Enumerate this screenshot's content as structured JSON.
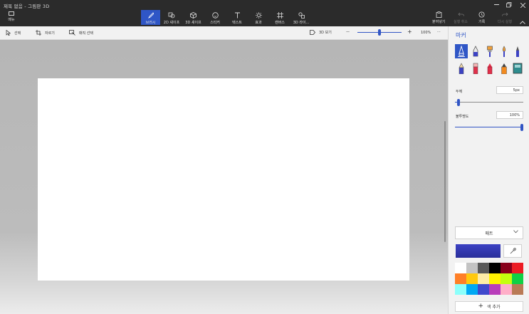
{
  "window": {
    "title": "제목 없음 - 그림판 3D"
  },
  "topbar": {
    "menu_label": "메뉴",
    "tools": [
      {
        "label": "브러시",
        "icon": "brush-icon"
      },
      {
        "label": "2D 셰이프",
        "icon": "2d-shapes-icon"
      },
      {
        "label": "3D 셰이프",
        "icon": "3d-shapes-icon"
      },
      {
        "label": "스티커",
        "icon": "sticker-icon"
      },
      {
        "label": "텍스트",
        "icon": "text-icon"
      },
      {
        "label": "효과",
        "icon": "effects-icon"
      },
      {
        "label": "캔버스",
        "icon": "canvas-icon"
      },
      {
        "label": "3D 라이...",
        "icon": "3d-library-icon"
      }
    ],
    "paste_label": "붙여넣기",
    "undo_label": "실행 취소",
    "history_label": "기록",
    "redo_label": "다시 실행"
  },
  "subbar": {
    "select_label": "선택",
    "crop_label": "자르기",
    "magic_select_label": "매직 선택",
    "view3d_label": "3D 보기",
    "zoom_minus": "—",
    "zoom_plus": "+",
    "zoom_percent": "100%",
    "more": "···",
    "zoom_fraction": 0.5
  },
  "panel": {
    "title": "마커",
    "thickness_label": "두께",
    "thickness_value": "5px",
    "thickness_fraction": 0.03,
    "opacity_label": "불투명도",
    "opacity_value": "100%",
    "opacity_fraction": 1.0,
    "finish_dropdown": "매트",
    "selected_color": "#3c42c3",
    "add_color_label": "색 추가",
    "brushes": [
      "marker-icon",
      "calligraphy-pen-icon",
      "oil-brush-icon",
      "watercolor-icon",
      "pixel-pen-icon",
      "pencil-icon",
      "eraser-icon",
      "crayon-icon",
      "spray-can-icon",
      "fill-icon"
    ],
    "palette": [
      "#ffffff",
      "#c3c3c3",
      "#585858",
      "#000000",
      "#88001b",
      "#ec1c24",
      "#ff7f27",
      "#ffc90e",
      "#fdeca6",
      "#fff200",
      "#c4ff0e",
      "#0ed145",
      "#8cfffb",
      "#00a8f3",
      "#3f48cc",
      "#b83dba",
      "#ffaec8",
      "#b97a56"
    ]
  }
}
